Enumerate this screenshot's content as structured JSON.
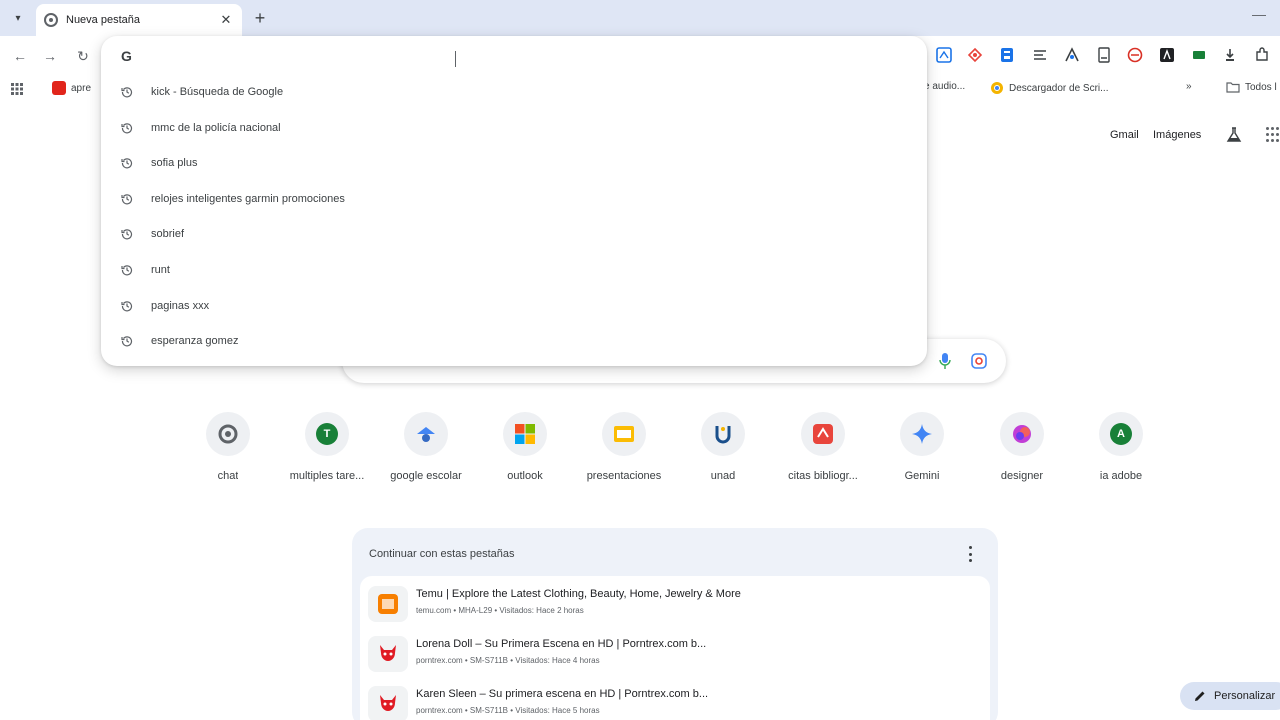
{
  "tabstrip": {
    "tab_title": "Nueva pestaña",
    "close_glyph": "✕",
    "new_tab_glyph": "+",
    "menu_glyph": "▾",
    "minimize_glyph": "—"
  },
  "toolbar": {
    "back_glyph": "←",
    "forward_glyph": "→",
    "reload_glyph": "↻"
  },
  "bookmarks": {
    "items": [
      {
        "label": "apre",
        "icon": "adobe-icon",
        "color": "#e1251b"
      },
      {
        "label": "e audio...",
        "icon": "bookmark-icon",
        "color": ""
      },
      {
        "label": "Descargador de Scri...",
        "icon": "chrome-color-icon",
        "color": "#f4b400"
      },
      {
        "label": "»",
        "icon": "overflow-icon",
        "color": ""
      },
      {
        "label": "Todos l",
        "icon": "folder-icon",
        "color": ""
      }
    ]
  },
  "omnibox": {
    "g_logo": "G",
    "input_value": "",
    "suggestions": [
      "kick - Búsqueda de Google",
      "mmc de la policía nacional",
      "sofia plus",
      "relojes inteligentes garmin promociones",
      "sobrief",
      "runt",
      "paginas xxx",
      "esperanza gomez"
    ]
  },
  "ntp": {
    "gmail": "Gmail",
    "images": "Imágenes"
  },
  "shortcuts": [
    {
      "label": "chat",
      "icon": "chat-icon",
      "letter": "",
      "color": "#5f6368"
    },
    {
      "label": "multiples tare...",
      "icon": "letter-t-icon",
      "letter": "T",
      "color": "#188038"
    },
    {
      "label": "google escolar",
      "icon": "scholar-icon",
      "letter": "",
      "color": "#4285f4"
    },
    {
      "label": "outlook",
      "icon": "microsoft-icon",
      "letter": "",
      "color": ""
    },
    {
      "label": "presentaciones",
      "icon": "slides-icon",
      "letter": "",
      "color": "#fbbc04"
    },
    {
      "label": "unad",
      "icon": "unad-icon",
      "letter": "",
      "color": "#1a4f8b"
    },
    {
      "label": "citas bibliogr...",
      "icon": "citation-icon",
      "letter": "",
      "color": "#e8453c"
    },
    {
      "label": "Gemini",
      "icon": "gemini-icon",
      "letter": "",
      "color": "#4285f4"
    },
    {
      "label": "designer",
      "icon": "designer-icon",
      "letter": "",
      "color": "#c13ed6"
    },
    {
      "label": "ia adobe",
      "icon": "letter-a-icon",
      "letter": "A",
      "color": "#188038"
    }
  ],
  "continue_card": {
    "title": "Continuar con estas pestañas",
    "rows": [
      {
        "title": "Temu | Explore the Latest Clothing, Beauty, Home, Jewelry & More",
        "subtitle": "temu.com • MHA-L29 • Visitados: Hace 2 horas",
        "icon": "temu-icon",
        "color": "#f77f00"
      },
      {
        "title": "Lorena Doll – Su Primera Escena en HD | Porntrex.com b...",
        "subtitle": "porntrex.com • SM-S711B • Visitados: Hace 4 horas",
        "icon": "devil-icon",
        "color": "#e01b24"
      },
      {
        "title": "Karen Sleen – Su primera escena en HD | Porntrex.com b...",
        "subtitle": "porntrex.com • SM-S711B • Visitados: Hace 5 horas",
        "icon": "devil-icon",
        "color": "#e01b24"
      }
    ]
  },
  "customize": {
    "label": "Personalizar"
  }
}
